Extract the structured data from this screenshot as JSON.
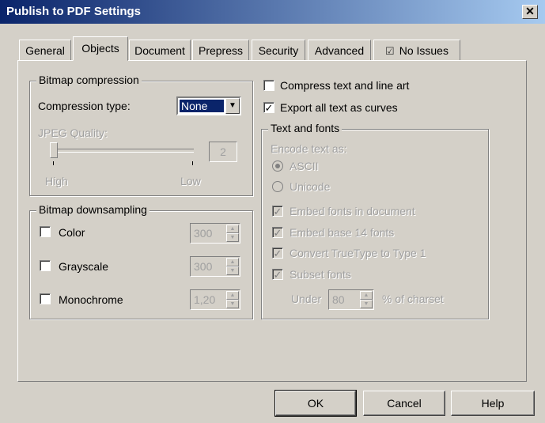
{
  "window": {
    "title": "Publish to PDF Settings",
    "close_glyph": "✕"
  },
  "tabs": [
    {
      "label": "General"
    },
    {
      "label": "Objects"
    },
    {
      "label": "Document"
    },
    {
      "label": "Prepress"
    },
    {
      "label": "Security"
    },
    {
      "label": "Advanced"
    },
    {
      "label": "No Issues",
      "icon": "checklist-icon"
    }
  ],
  "active_tab": "Objects",
  "bitmap_compression": {
    "legend": "Bitmap compression",
    "compression_type_label": "Compression type:",
    "compression_type_value": "None",
    "jpeg_quality_label": "JPEG Quality:",
    "jpeg_quality_value": "2",
    "high_label": "High",
    "low_label": "Low"
  },
  "bitmap_downsampling": {
    "legend": "Bitmap downsampling",
    "items": [
      {
        "label": "Color",
        "checked": false,
        "value": "300"
      },
      {
        "label": "Grayscale",
        "checked": false,
        "value": "300"
      },
      {
        "label": "Monochrome",
        "checked": false,
        "value": "1,20"
      }
    ]
  },
  "right_options": {
    "compress_text": {
      "label": "Compress text and line art",
      "checked": false
    },
    "export_curves": {
      "label": "Export all text as curves",
      "checked": true
    }
  },
  "text_fonts": {
    "legend": "Text and fonts",
    "encode_label": "Encode text as:",
    "encodings": [
      {
        "label": "ASCII",
        "selected": true
      },
      {
        "label": "Unicode",
        "selected": false
      }
    ],
    "checks": [
      {
        "label": "Embed fonts in document",
        "checked": true
      },
      {
        "label": "Embed base 14 fonts",
        "checked": true
      },
      {
        "label": "Convert TrueType to Type 1",
        "checked": true
      },
      {
        "label": "Subset fonts",
        "checked": true
      }
    ],
    "under_label": "Under",
    "under_value": "80",
    "charset_label": "% of charset"
  },
  "buttons": {
    "ok": "OK",
    "cancel": "Cancel",
    "help": "Help"
  },
  "glyphs": {
    "check": "✓",
    "dropdown": "▼",
    "up": "▲",
    "down": "▼"
  }
}
